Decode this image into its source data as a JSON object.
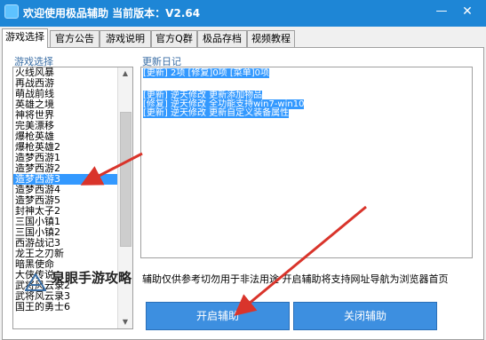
{
  "window": {
    "title": "欢迎使用极品辅助  当前版本：V2.64",
    "min_glyph": "—",
    "close_glyph": "✕"
  },
  "tabs": [
    {
      "label": "游戏选择",
      "active": true
    },
    {
      "label": "官方公告",
      "active": false
    },
    {
      "label": "游戏说明",
      "active": false
    },
    {
      "label": "官方Q群",
      "active": false
    },
    {
      "label": "极品存档",
      "active": false
    },
    {
      "label": "视频教程",
      "active": false
    }
  ],
  "game_list": {
    "label": "游戏选择",
    "items": [
      "火线风暴",
      "再战西游",
      "萌战前线",
      "英雄之境",
      "神将世界",
      "完美漂移",
      "爆枪英雄",
      "爆枪英雄2",
      "造梦西游1",
      "造梦西游2",
      "造梦西游3",
      "造梦西游4",
      "造梦西游5",
      "封神太子2",
      "三国小镇1",
      "三国小镇2",
      "西游战记3",
      "龙王之刃新",
      "暗黑使命",
      "大侠传说",
      "武将风云录2",
      "武将风云录3",
      "国王的勇士6"
    ],
    "selected_index": 10
  },
  "changelog": {
    "label": "更新日记",
    "summary": "[更新] 2项 [修复]0项 [菜单]0项",
    "entries": [
      "[更新] 逆天修改 更新添加物品",
      "[修复] 逆天修改 全功能支持win7-win10",
      "[更新] 逆天修改 更新自定义装备属性"
    ]
  },
  "notice": "辅助仅供参考切勿用于非法用途  开启辅助将支持网址导航为浏览器首页",
  "buttons": {
    "start": "开启辅助",
    "close": "关闭辅助"
  },
  "watermark": {
    "text": "泉眼手游攻略"
  },
  "colors": {
    "title_bar": "#1e86d6",
    "selection": "#3399ff",
    "button": "#3d8fe0",
    "arrow": "#d9342b"
  }
}
